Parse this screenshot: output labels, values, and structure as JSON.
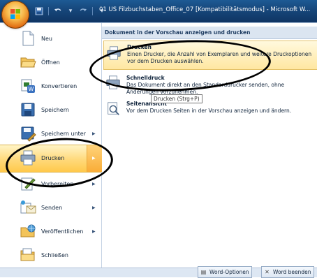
{
  "window": {
    "title": "01 US Filzbuchstaben_Office_07 [Kompatibilitätsmodus] - Microsoft W..."
  },
  "qat": {
    "buttons": [
      "save-icon",
      "undo-icon",
      "dropdown-icon",
      "redo-icon",
      "customize-icon"
    ]
  },
  "menu": {
    "items": [
      {
        "label": "Neu",
        "icon": "new-document-icon",
        "submenu": false
      },
      {
        "label": "Öffnen",
        "icon": "folder-open-icon",
        "submenu": false
      },
      {
        "label": "Konvertieren",
        "icon": "convert-icon",
        "submenu": false
      },
      {
        "label": "Speichern",
        "icon": "save-icon",
        "submenu": false
      },
      {
        "label": "Speichern unter",
        "icon": "save-as-icon",
        "submenu": true
      },
      {
        "label": "Drucken",
        "icon": "printer-icon",
        "submenu": true,
        "selected": true
      },
      {
        "label": "Vorbereiten",
        "icon": "prepare-icon",
        "submenu": true
      },
      {
        "label": "Senden",
        "icon": "send-icon",
        "submenu": true
      },
      {
        "label": "Veröffentlichen",
        "icon": "publish-icon",
        "submenu": true
      },
      {
        "label": "Schließen",
        "icon": "close-folder-icon",
        "submenu": false
      }
    ]
  },
  "submenu": {
    "header": "Dokument in der Vorschau anzeigen und drucken",
    "options": [
      {
        "title": "Drucken",
        "desc": "Einen Drucker, die Anzahl von Exemplaren und weitere Druckoptionen vor dem Drucken auswählen.",
        "icon": "printer-icon"
      },
      {
        "title": "Schnelldruck",
        "desc": "Das Dokument direkt an den Standarddrucker senden, ohne Änderungen vorzunehmen.",
        "icon": "quick-print-icon"
      },
      {
        "title": "Seitenansicht",
        "desc": "Vor dem Drucken Seiten in der Vorschau anzeigen und ändern.",
        "icon": "print-preview-icon"
      }
    ],
    "tooltip": "Drucken (Strg+P)"
  },
  "footer": {
    "options_label": "Word-Optionen",
    "exit_label": "Word beenden"
  },
  "colors": {
    "titlebar": "#16467a",
    "selection": "#ffd97a",
    "annotation_ring": "#000000"
  }
}
